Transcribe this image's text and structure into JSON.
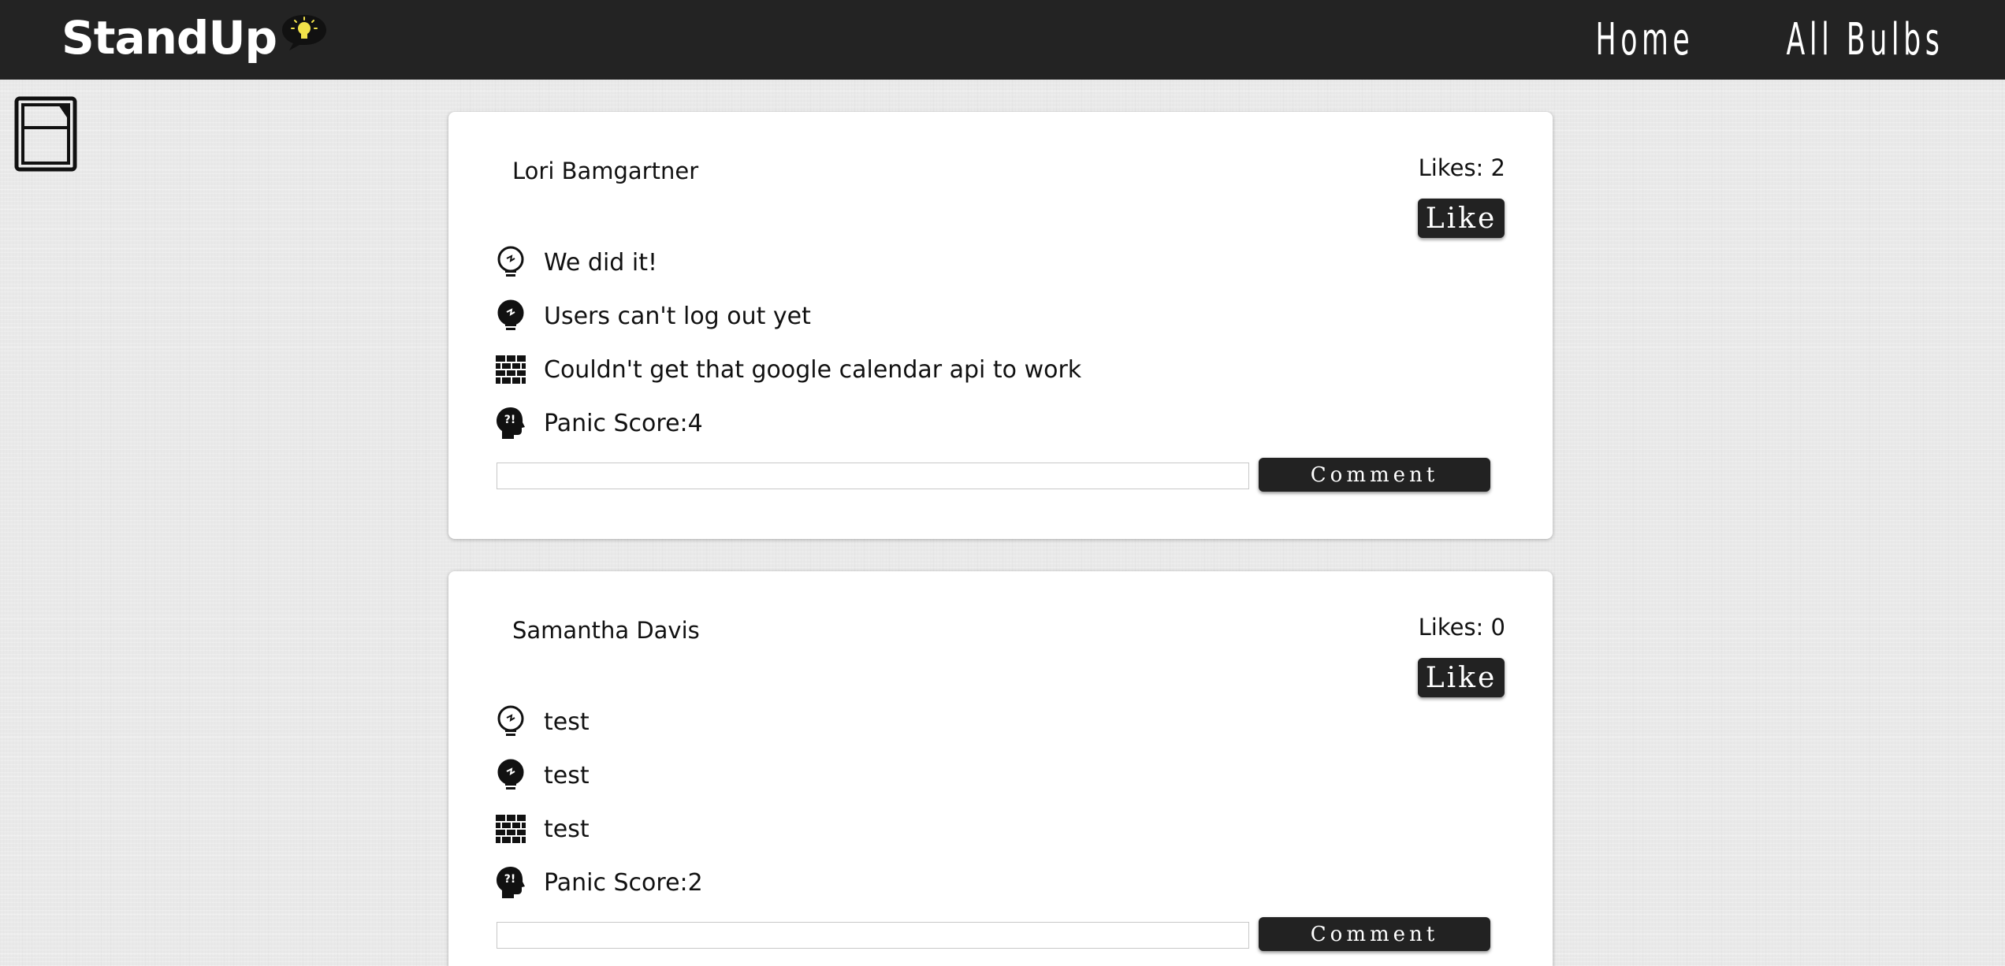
{
  "app": {
    "brand": "StandUp",
    "brand_icon": "lightbulb-speech-bubble-icon"
  },
  "nav": {
    "home_label": "Home",
    "all_bulbs_label": "All Bulbs"
  },
  "sidebar": {
    "toggle_icon": "sidebar-panel-icon"
  },
  "colors": {
    "navbar": "#232323",
    "button": "#222222",
    "card": "#ffffff",
    "page_background": "#e9e9e9",
    "bulb_glow": "#f2e24a"
  },
  "posts": [
    {
      "author": "Lori Bamgartner",
      "likes_text": "Likes: 2",
      "like_label": "Like",
      "items": [
        {
          "icon": "lightbulb-outline-icon",
          "text": "We did it!"
        },
        {
          "icon": "lightbulb-filled-icon",
          "text": "Users can't log out yet"
        },
        {
          "icon": "brick-wall-icon",
          "text": "Couldn't get that google calendar api to work"
        },
        {
          "icon": "panic-head-icon",
          "text": "Panic Score:4"
        }
      ],
      "comment_placeholder": "",
      "comment_label": "Comment"
    },
    {
      "author": "Samantha Davis",
      "likes_text": "Likes: 0",
      "like_label": "Like",
      "items": [
        {
          "icon": "lightbulb-outline-icon",
          "text": "test"
        },
        {
          "icon": "lightbulb-filled-icon",
          "text": "test"
        },
        {
          "icon": "brick-wall-icon",
          "text": "test"
        },
        {
          "icon": "panic-head-icon",
          "text": "Panic Score:2"
        }
      ],
      "comment_placeholder": "",
      "comment_label": "Comment"
    }
  ]
}
